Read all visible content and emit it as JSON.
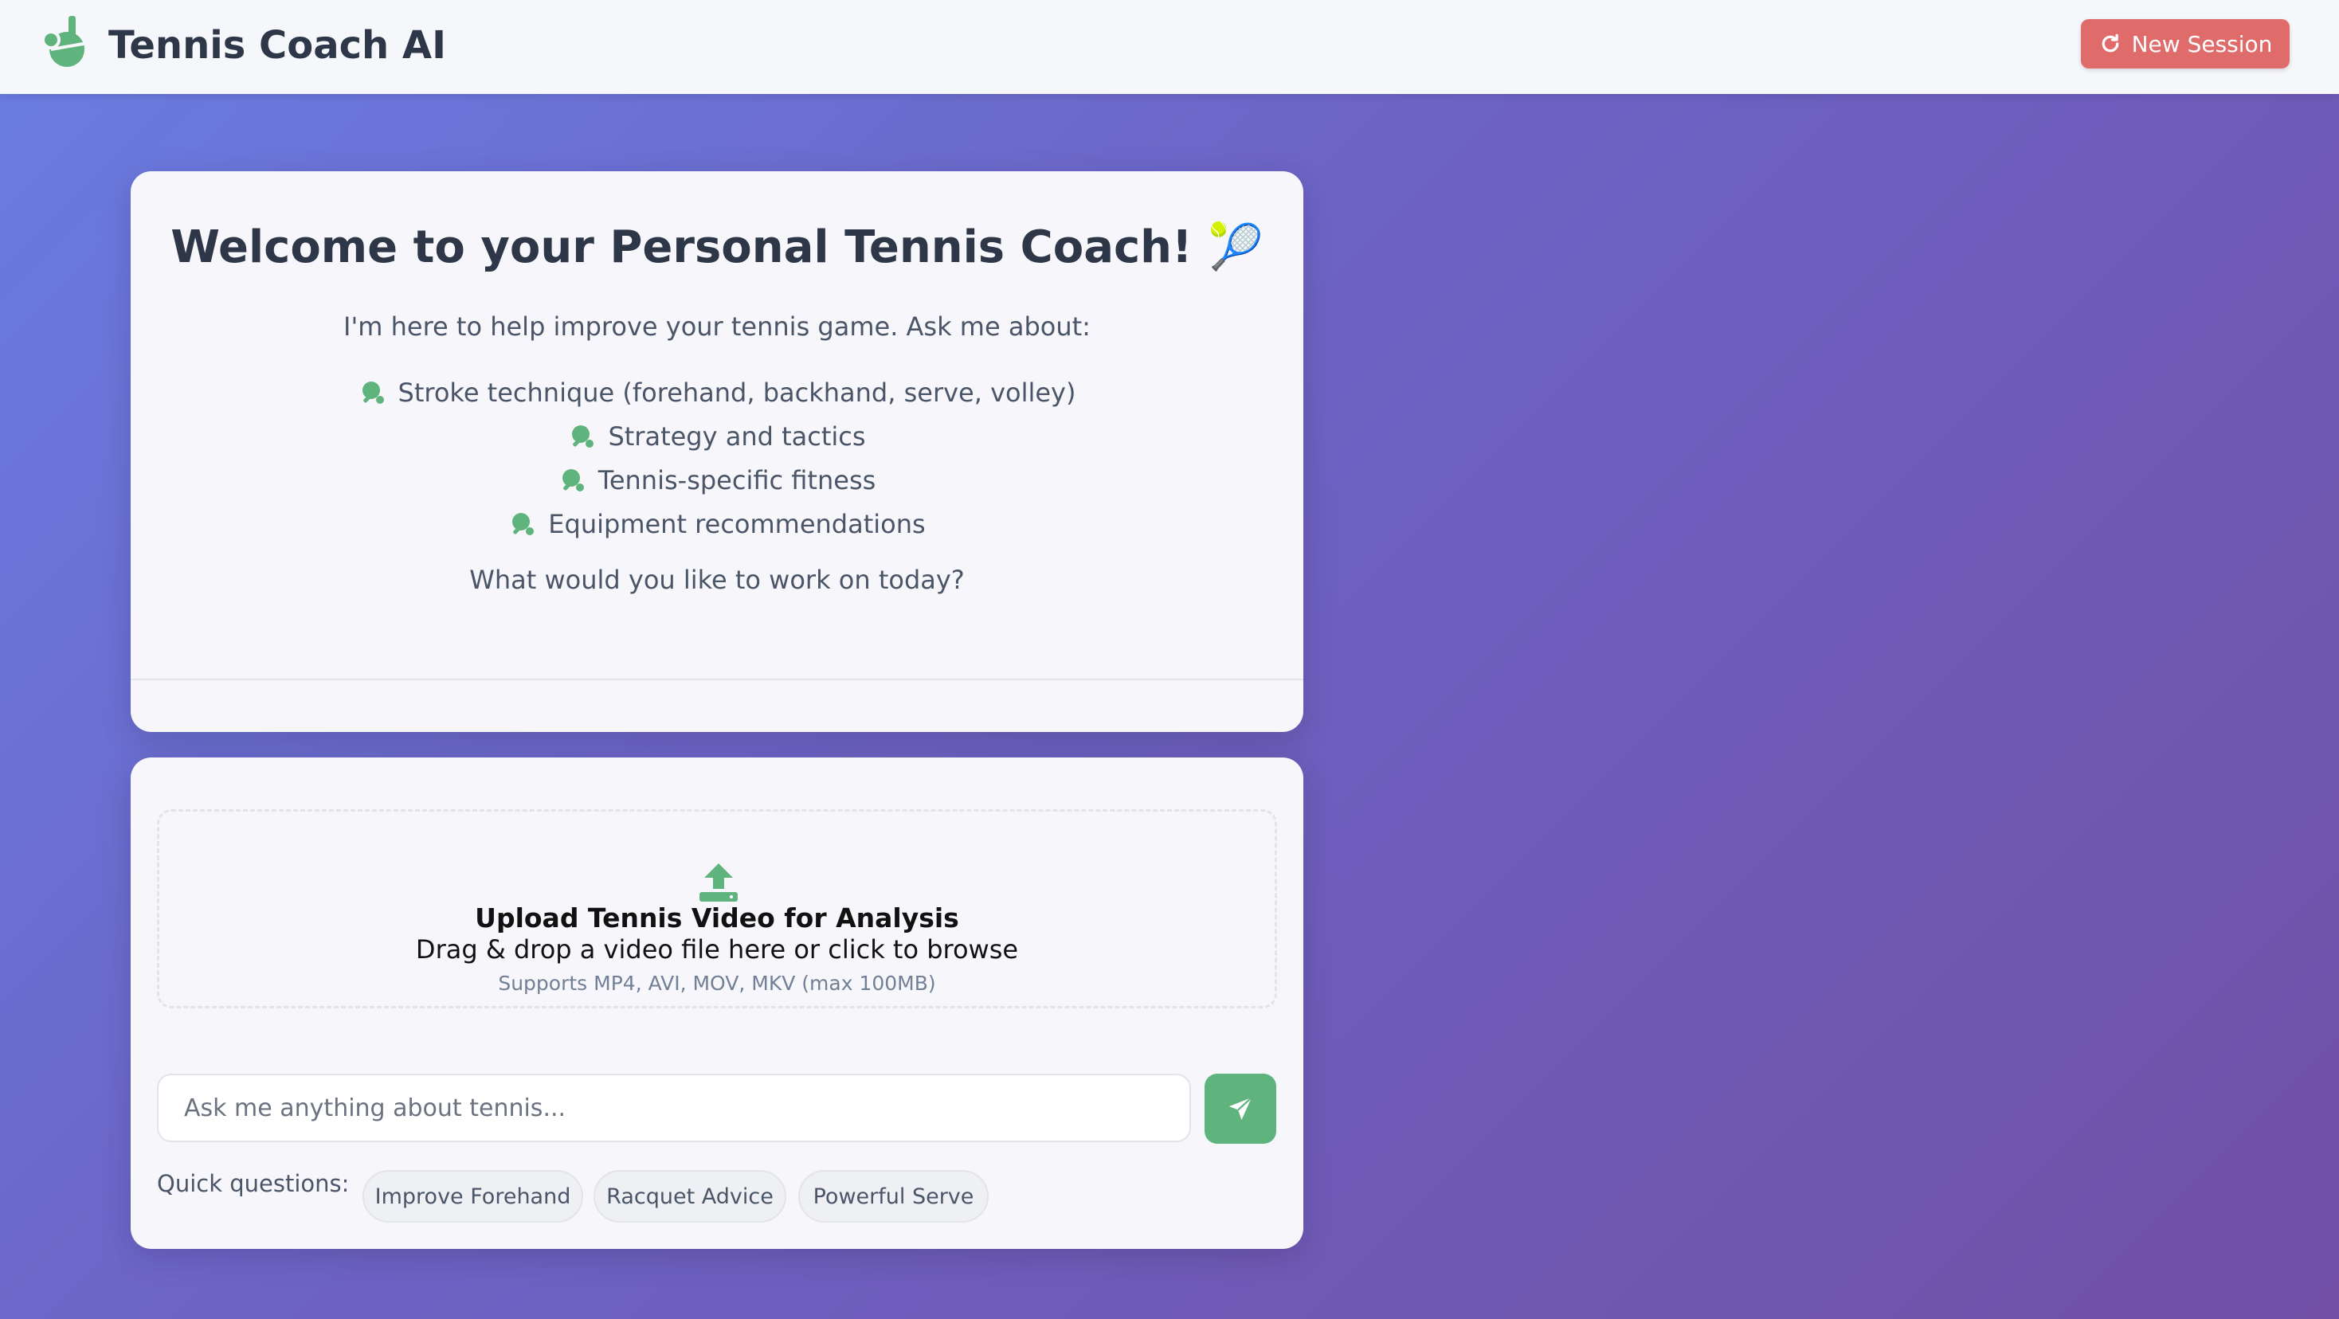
{
  "header": {
    "app_title": "Tennis Coach AI",
    "new_session_label": "New Session"
  },
  "welcome": {
    "title": "Welcome to your Personal Tennis Coach! 🎾",
    "intro": "I'm here to help improve your tennis game. Ask me about:",
    "topics": [
      "Stroke technique (forehand, backhand, serve, volley)",
      "Strategy and tactics",
      "Tennis-specific fitness",
      "Equipment recommendations"
    ],
    "outro": "What would you like to work on today?"
  },
  "upload": {
    "title": "Upload Tennis Video for Analysis",
    "description": "Drag & drop a video file here or click to browse",
    "hint": "Supports MP4, AVI, MOV, MKV (max 100MB)"
  },
  "chat": {
    "placeholder": "Ask me anything about tennis...",
    "quick_label": "Quick questions:",
    "quick_questions": [
      "Improve Forehand",
      "Racquet Advice",
      "Powerful Serve"
    ]
  },
  "colors": {
    "accent_green": "#5fb37c",
    "danger_red": "#e06b6b",
    "heading_text": "#2d3748"
  }
}
